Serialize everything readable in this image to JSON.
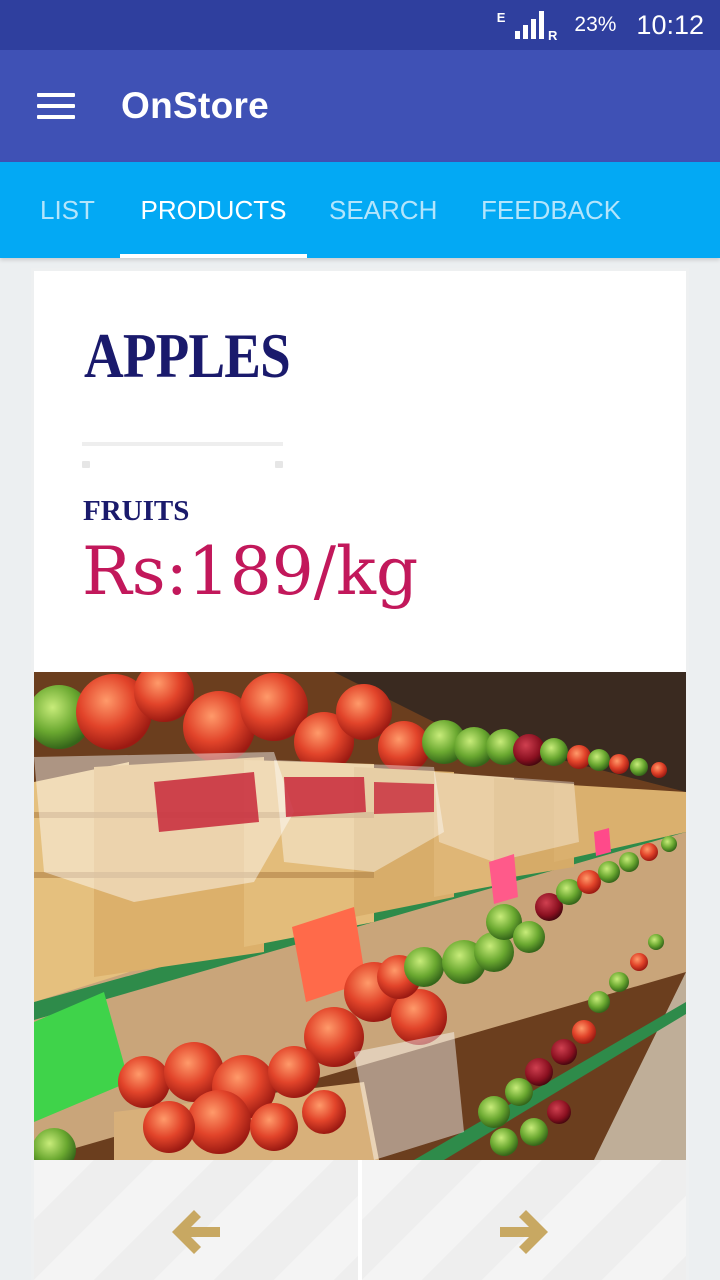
{
  "status_bar": {
    "network_type": "E",
    "roaming_indicator": "R",
    "battery": "23%",
    "time": "10:12"
  },
  "app_bar": {
    "title": "OnStore",
    "menu_icon": "hamburger-menu-icon"
  },
  "tabs": [
    {
      "label": "LIST",
      "active": false
    },
    {
      "label": "PRODUCTS",
      "active": true
    },
    {
      "label": "SEARCH",
      "active": false
    },
    {
      "label": "FEEDBACK",
      "active": false
    }
  ],
  "product": {
    "name": "APPLES",
    "category": "FRUITS",
    "price": "Rs:189/kg"
  },
  "navigation": {
    "prev_icon": "arrow-left-icon",
    "next_icon": "arrow-right-icon"
  },
  "colors": {
    "status_bar": "#2f3f9e",
    "app_bar": "#3f51b5",
    "tab_bar": "#03a9f4",
    "title_navy": "#1a1a6c",
    "price_pink": "#c2185b",
    "arrow_gold": "#c8a862"
  }
}
